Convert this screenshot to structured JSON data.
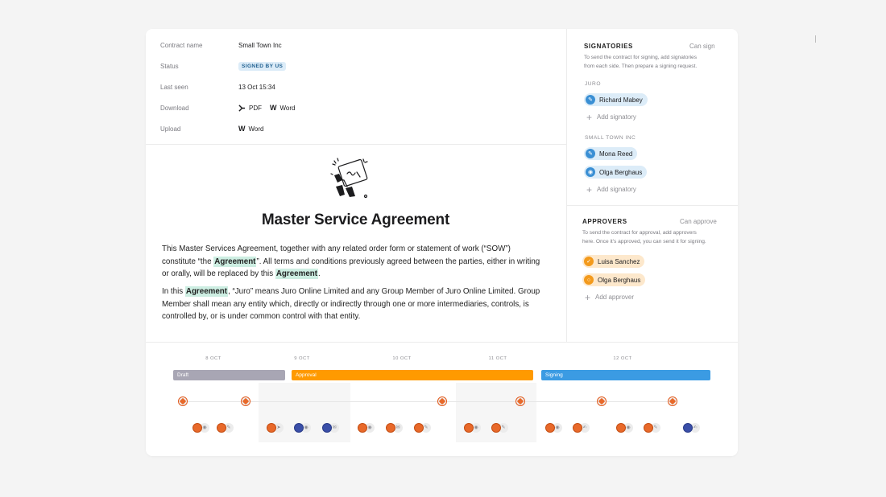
{
  "details": {
    "contract_name_label": "Contract name",
    "contract_name_value": "Small Town Inc",
    "status_label": "Status",
    "status_value": "SIGNED BY US",
    "last_seen_label": "Last seen",
    "last_seen_value": "13 Oct 15:34",
    "download_label": "Download",
    "download_pdf": "PDF",
    "download_word": "Word",
    "upload_label": "Upload",
    "upload_word": "Word"
  },
  "document": {
    "title": "Master Service Agreement",
    "p1_a": "This Master Services Agreement, together with any related order form or statement of work (“SOW”) constitute “the ",
    "p1_hl1": "Agreement",
    "p1_b": "”. All terms and conditions previously agreed between the parties, either in writing or orally, will be replaced by this ",
    "p1_hl2": "Agreement",
    "p1_c": ".",
    "p2_a": "In this ",
    "p2_hl": "Agreement",
    "p2_b": ", “Juro” means Juro Online Limited and any Group Member of Juro Online Limited. Group Member shall mean any entity which, directly or indirectly through one or more intermediaries, controls, is controlled by, or is under common control with that entity."
  },
  "signatories": {
    "heading": "SIGNATORIES",
    "right_label": "Can sign",
    "description_line1": "To send the contract for signing, add signatories",
    "description_line2": "from each side. Then prepare a signing request.",
    "group1": "JURO",
    "group1_people": [
      "Richard Mabey"
    ],
    "group2": "SMALL TOWN INC",
    "group2_people": [
      "Mona Reed",
      "Olga Berghaus"
    ],
    "add_label": "Add signatory"
  },
  "approvers": {
    "heading": "APPROVERS",
    "right_label": "Can approve",
    "description_line1": "To send the contract for approval, add approvers",
    "description_line2": "here. Once it's approved, you can send it for signing.",
    "people": [
      "Luisa Sanchez",
      "Olga Berghaus"
    ],
    "add_label": "Add approver"
  },
  "timeline": {
    "dates": [
      "8 OCT",
      "9 OCT",
      "10 OCT",
      "11 OCT",
      "12 OCT"
    ],
    "phases": [
      "Draft",
      "Approval",
      "Signing"
    ],
    "colors": {
      "draft": "#a8a6b4",
      "approval": "#ff9a00",
      "signing": "#3b9be3"
    }
  }
}
